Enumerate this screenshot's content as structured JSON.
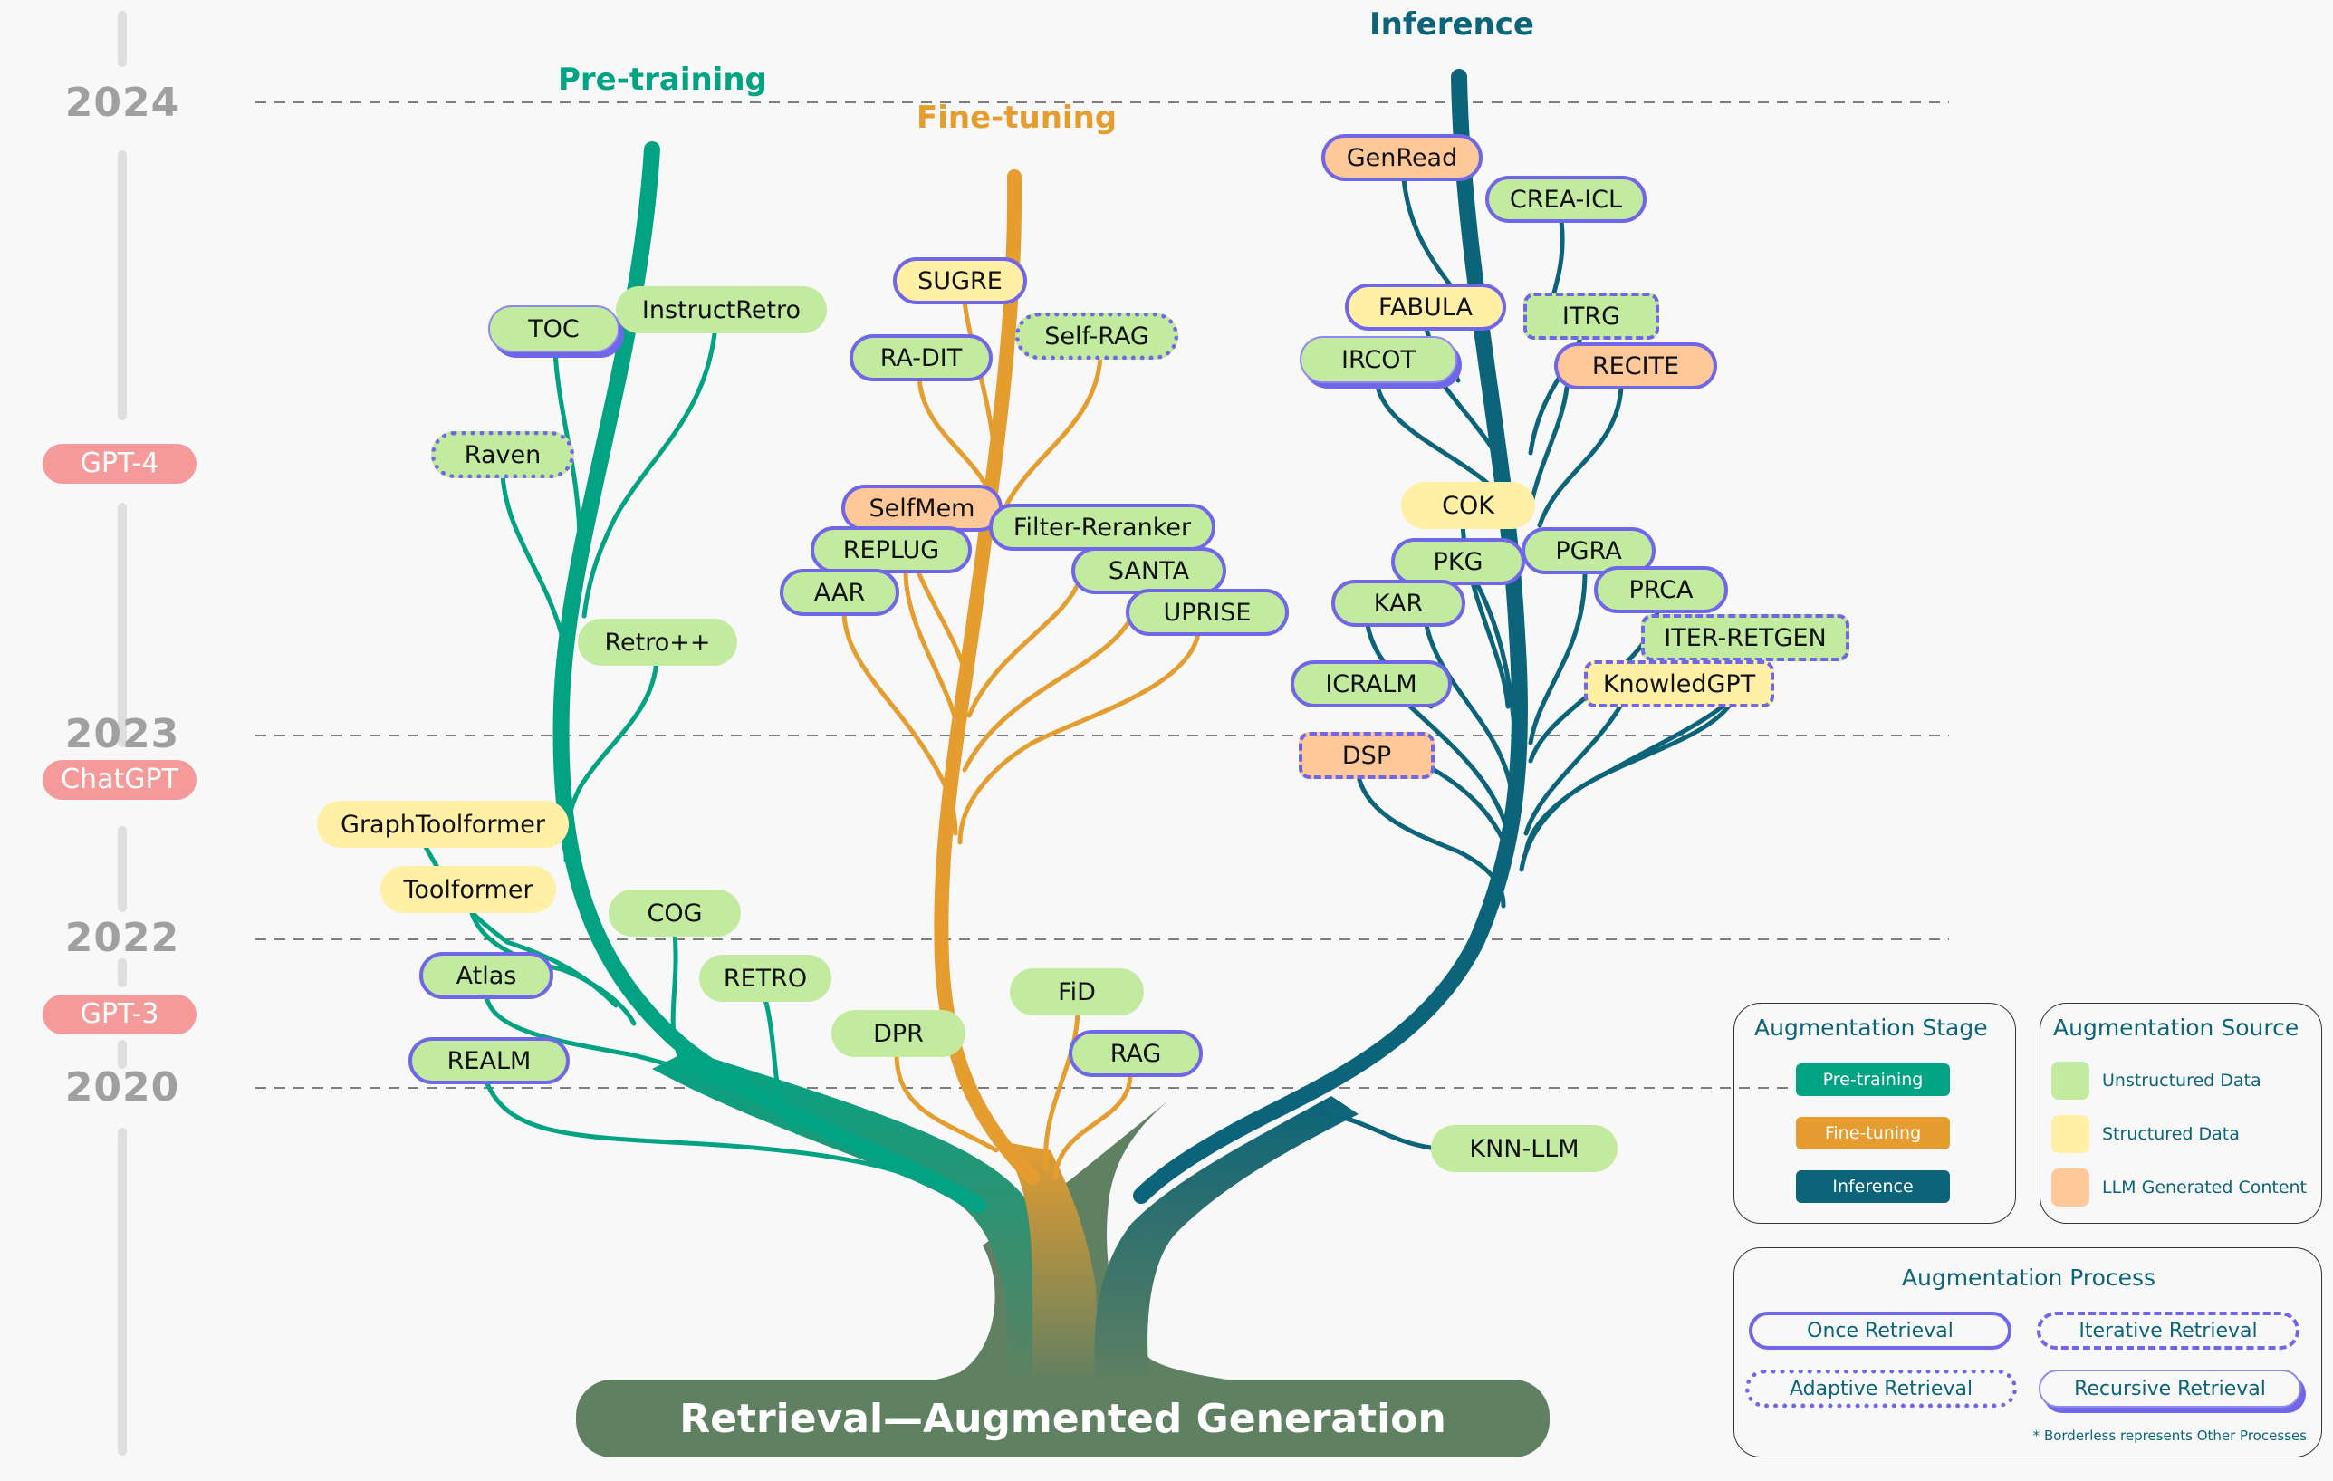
{
  "root": {
    "label": "Retrieval—Augmented Generation"
  },
  "timeline": {
    "years": [
      {
        "id": "y2024",
        "label": "2024"
      },
      {
        "id": "y2023",
        "label": "2023"
      },
      {
        "id": "y2022",
        "label": "2022"
      },
      {
        "id": "y2020",
        "label": "2020"
      }
    ],
    "milestones": [
      {
        "id": "gpt4",
        "label": "GPT-4"
      },
      {
        "id": "chatgpt",
        "label": "ChatGPT"
      },
      {
        "id": "gpt3",
        "label": "GPT-3"
      }
    ]
  },
  "stages": {
    "pretraining": {
      "label": "Pre-training",
      "color": "#02a383"
    },
    "finetuning": {
      "label": "Fine-tuning",
      "color": "#e59d30"
    },
    "inference": {
      "label": "Inference",
      "color": "#0b6479"
    }
  },
  "colors": {
    "unstructured": "#c2eba0",
    "structured": "#fff0a5",
    "llm_generated": "#ffc898",
    "process_border": "#7066e8",
    "milestone": "#f49a9a",
    "root": "#5f8061",
    "year_text": "#a0a0a0"
  },
  "nodes": {
    "pretraining": [
      {
        "name": "TOC",
        "source": "unstructured",
        "process": "recursive"
      },
      {
        "name": "InstructRetro",
        "source": "unstructured",
        "process": "none"
      },
      {
        "name": "Raven",
        "source": "unstructured",
        "process": "adaptive"
      },
      {
        "name": "Retro++",
        "source": "unstructured",
        "process": "none"
      },
      {
        "name": "GraphToolformer",
        "source": "structured",
        "process": "none"
      },
      {
        "name": "Toolformer",
        "source": "structured",
        "process": "none"
      },
      {
        "name": "COG",
        "source": "unstructured",
        "process": "none"
      },
      {
        "name": "Atlas",
        "source": "unstructured",
        "process": "once"
      },
      {
        "name": "RETRO",
        "source": "unstructured",
        "process": "none"
      },
      {
        "name": "REALM",
        "source": "unstructured",
        "process": "once"
      }
    ],
    "finetuning": [
      {
        "name": "SUGRE",
        "source": "structured",
        "process": "once"
      },
      {
        "name": "RA-DIT",
        "source": "unstructured",
        "process": "once"
      },
      {
        "name": "Self-RAG",
        "source": "unstructured",
        "process": "adaptive"
      },
      {
        "name": "SelfMem",
        "source": "llm",
        "process": "once"
      },
      {
        "name": "Filter-Reranker",
        "source": "unstructured",
        "process": "once"
      },
      {
        "name": "REPLUG",
        "source": "unstructured",
        "process": "once"
      },
      {
        "name": "SANTA",
        "source": "unstructured",
        "process": "once"
      },
      {
        "name": "AAR",
        "source": "unstructured",
        "process": "once"
      },
      {
        "name": "UPRISE",
        "source": "unstructured",
        "process": "once"
      },
      {
        "name": "DPR",
        "source": "unstructured",
        "process": "none"
      },
      {
        "name": "FiD",
        "source": "unstructured",
        "process": "none"
      },
      {
        "name": "RAG",
        "source": "unstructured",
        "process": "once"
      }
    ],
    "inference": [
      {
        "name": "GenRead",
        "source": "llm",
        "process": "once"
      },
      {
        "name": "CREA-ICL",
        "source": "unstructured",
        "process": "once"
      },
      {
        "name": "FABULA",
        "source": "structured",
        "process": "once"
      },
      {
        "name": "ITRG",
        "source": "unstructured",
        "process": "iterative"
      },
      {
        "name": "IRCOT",
        "source": "unstructured",
        "process": "recursive"
      },
      {
        "name": "RECITE",
        "source": "llm",
        "process": "once"
      },
      {
        "name": "COK",
        "source": "structured",
        "process": "none"
      },
      {
        "name": "PKG",
        "source": "unstructured",
        "process": "once"
      },
      {
        "name": "PGRA",
        "source": "unstructured",
        "process": "once"
      },
      {
        "name": "KAR",
        "source": "unstructured",
        "process": "once"
      },
      {
        "name": "PRCA",
        "source": "unstructured",
        "process": "once"
      },
      {
        "name": "ITER-RETGEN",
        "source": "unstructured",
        "process": "iterative"
      },
      {
        "name": "ICRALM",
        "source": "unstructured",
        "process": "once"
      },
      {
        "name": "KnowledGPT",
        "source": "structured",
        "process": "iterative"
      },
      {
        "name": "DSP",
        "source": "llm",
        "process": "iterative"
      },
      {
        "name": "KNN-LLM",
        "source": "unstructured",
        "process": "none"
      }
    ]
  },
  "legend": {
    "stage": {
      "title": "Augmentation Stage",
      "items": [
        "Pre-training",
        "Fine-tuning",
        "Inference"
      ]
    },
    "source": {
      "title": "Augmentation Source",
      "items": [
        "Unstructured Data",
        "Structured Data",
        "LLM Generated Content"
      ]
    },
    "process": {
      "title": "Augmentation Process",
      "items": [
        "Once Retrieval",
        "Iterative Retrieval",
        "Adaptive Retrieval",
        "Recursive Retrieval"
      ],
      "footnote": "* Borderless represents Other Processes"
    }
  }
}
